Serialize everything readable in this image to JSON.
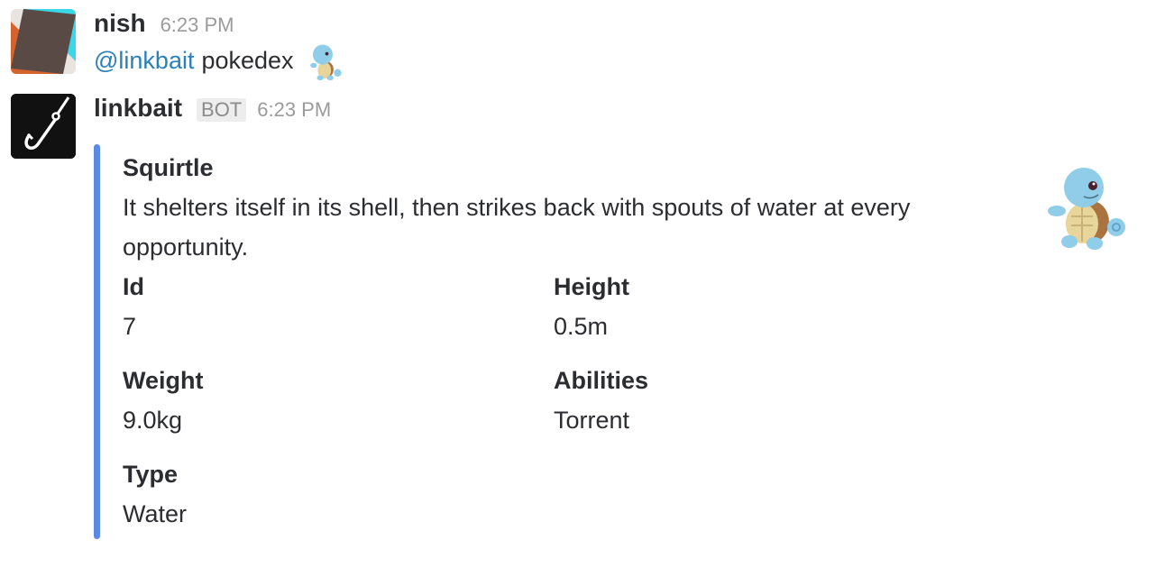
{
  "messages": [
    {
      "sender": "nish",
      "time": "6:23 PM",
      "mention": "@linkbait",
      "text": "pokedex",
      "avatar_colors": [
        "#3ad7e6",
        "#d5642c",
        "#5a4a45",
        "#e9e4df"
      ],
      "emoji_icon": "squirtle-emoji-icon"
    },
    {
      "sender": "linkbait",
      "badge": "BOT",
      "time": "6:23 PM",
      "avatar_icon": "fish-hook-icon",
      "attachment": {
        "accent_color": "#5b8ae6",
        "title": "Squirtle",
        "text": "It shelters itself in its shell, then strikes back with spouts of water at every opportunity.",
        "thumb_icon": "squirtle-icon",
        "fields": [
          {
            "title": "Id",
            "value": "7"
          },
          {
            "title": "Height",
            "value": "0.5m"
          },
          {
            "title": "Weight",
            "value": "9.0kg"
          },
          {
            "title": "Abilities",
            "value": "Torrent"
          },
          {
            "title": "Type",
            "value": "Water"
          }
        ]
      }
    }
  ]
}
